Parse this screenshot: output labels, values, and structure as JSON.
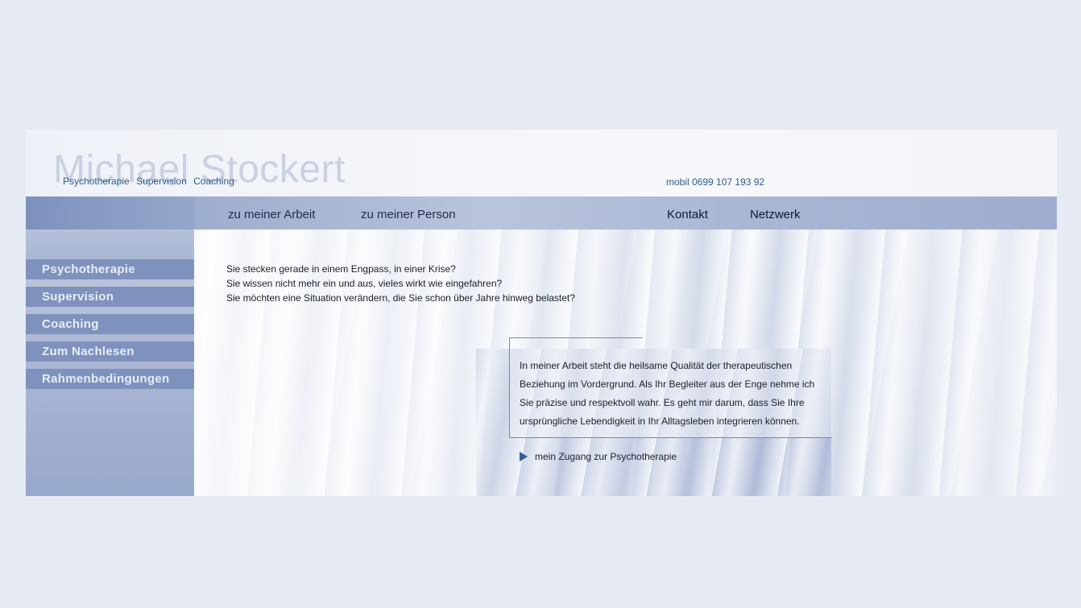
{
  "header": {
    "brand_name": "Michael Stockert",
    "tagline": [
      "Psychotherapie",
      "Supervision",
      "Coaching"
    ],
    "phone": "mobil 0699 107 193 92"
  },
  "nav": {
    "left": [
      "zu meiner Arbeit",
      "zu meiner Person"
    ],
    "right": [
      "Kontakt",
      "Netzwerk"
    ]
  },
  "sidebar": {
    "items": [
      {
        "label": "Psychotherapie"
      },
      {
        "label": "Supervision"
      },
      {
        "label": "Coaching"
      },
      {
        "label": "Zum Nachlesen"
      },
      {
        "label": "Rahmenbedingungen"
      }
    ]
  },
  "main": {
    "intro_lines": [
      "Sie stecken gerade in einem Engpass, in einer Krise?",
      "Sie wissen nicht mehr ein und aus, vieles wirkt wie eingefahren?",
      "Sie möchten eine Situation verändern, die Sie schon über Jahre hinweg belastet?"
    ],
    "quote": "In meiner Arbeit steht die heilsame Qualität der therapeutischen Beziehung im Vordergrund. Als Ihr Begleiter aus der Enge nehme ich Sie präzise und respektvoll wahr. Es geht mir darum, dass Sie Ihre ursprüngliche Lebendigkeit in Ihr Alltagsleben integrieren können.",
    "link_label": "mein Zugang zur Psychotherapie",
    "link_icon": "triangle-right-icon"
  },
  "colors": {
    "page_bg": "#e6eaf2",
    "accent_blue": "#2f5b8c",
    "sidebar_item_bg": "#7e92bd",
    "brand_watermark": "#c9d0e1"
  }
}
